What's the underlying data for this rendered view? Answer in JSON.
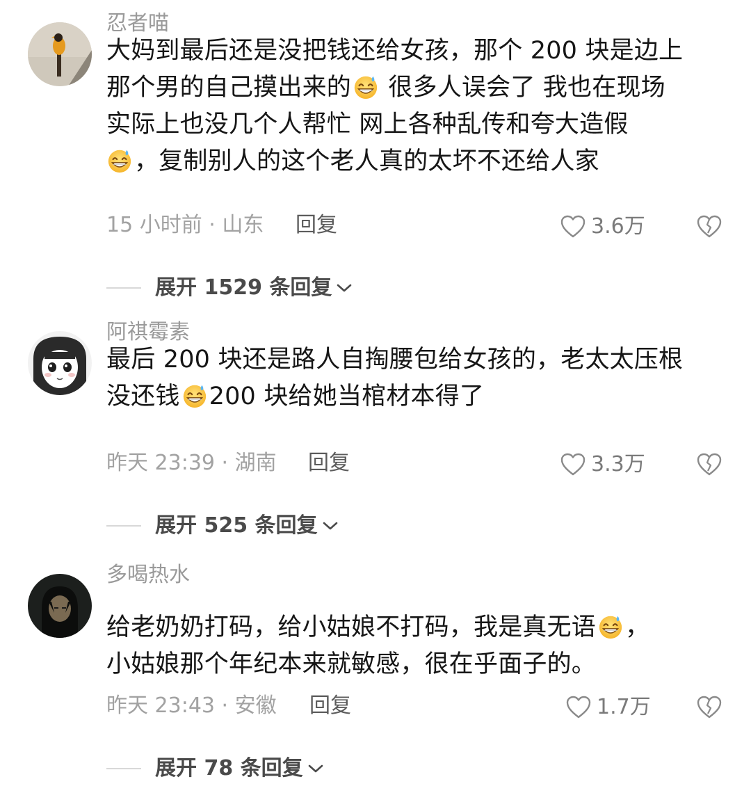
{
  "comments": [
    {
      "username": "忍者喵",
      "avatar_icon": "bird-avatar",
      "lines": [
        "大妈到最后还是没把钱还给女孩，那个 200 块是边上",
        "那个男的自己摸出来的",
        " 很多人误会了 我也在现场",
        "实际上也没几个人帮忙 网上各种乱传和夸大造假",
        "，复制别人的这个老人真的太坏不还给人家"
      ],
      "time_location": "15 小时前 · 山东",
      "reply_label": "回复",
      "likes": "3.6万",
      "expand_label": "展开 1529 条回复"
    },
    {
      "username": "阿祺霉素",
      "avatar_icon": "anime-girl-avatar",
      "lines": [
        "最后 200 块还是路人自掏腰包给女孩的，老太太压根",
        "没还钱",
        "200 块给她当棺材本得了"
      ],
      "time_location": "昨天 23:39 · 湖南",
      "reply_label": "回复",
      "likes": "3.3万",
      "expand_label": "展开 525 条回复"
    },
    {
      "username": "多喝热水",
      "avatar_icon": "dark-character-avatar",
      "lines": [
        "给老奶奶打码，给小姑娘不打码，我是真无语",
        "，",
        "小姑娘那个年纪本来就敏感，很在乎面子的。"
      ],
      "time_location": "昨天 23:43 · 安徽",
      "reply_label": "回复",
      "likes": "1.7万",
      "expand_label": "展开 78 条回复"
    }
  ],
  "icons": {
    "like": "heart-outline-icon",
    "dislike": "broken-heart-icon",
    "expand": "chevron-down-icon",
    "emoji": "grinning-sweat-emoji"
  },
  "colors": {
    "username": "#9a9a9a",
    "body": "#161616",
    "meta": "#a2a2a2",
    "reply": "#5b5b5b",
    "expand": "#4a4a4a"
  }
}
